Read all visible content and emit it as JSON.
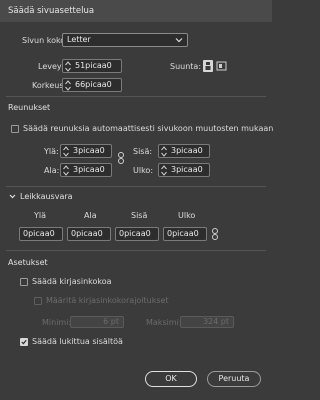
{
  "window": {
    "title": "Säädä sivuasettelua"
  },
  "page_size": {
    "label": "Sivun koko:",
    "selected": "Letter",
    "width_label": "Leveys:",
    "width_value": "51picaa0",
    "height_label": "Korkeus:",
    "height_value": "66picaa0",
    "orientation_label": "Suunta:"
  },
  "margins": {
    "title": "Reunukset",
    "auto_adjust_label": "Säädä reunuksia automaattisesti sivukoon muutosten mukaan",
    "auto_adjust_checked": false,
    "top_label": "Ylä:",
    "top_value": "3picaa0",
    "bottom_label": "Ala:",
    "bottom_value": "3picaa0",
    "inside_label": "Sisä:",
    "inside_value": "3picaa0",
    "outside_label": "Ulko:",
    "outside_value": "3picaa0"
  },
  "bleed": {
    "title": "Leikkausvara",
    "col_top": "Ylä",
    "col_bottom": "Ala",
    "col_inside": "Sisä",
    "col_outside": "Ulko",
    "top_value": "0picaa0",
    "bottom_value": "0picaa0",
    "inside_value": "0picaa0",
    "outside_value": "0picaa0"
  },
  "options": {
    "title": "Asetukset",
    "adjust_font_size_label": "Säädä kirjasinkokoa",
    "adjust_font_size_checked": false,
    "limits_label": "Määritä kirjasinkokorajoitukset",
    "min_label": "Minimi:",
    "min_value": "6 pt",
    "max_label": "Maksimi:",
    "max_value": "324 pt",
    "locked_text_label": "Säädä lukittua sisältöä",
    "locked_text_checked": true
  },
  "buttons": {
    "ok": "OK",
    "cancel": "Peruuta"
  },
  "colors": {
    "background": "#3b3b3b",
    "titlebar": "#4a4a4a",
    "text": "#dcdcdc",
    "field": "#2d2d2d"
  }
}
